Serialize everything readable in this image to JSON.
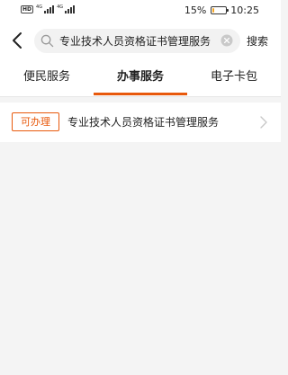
{
  "status_bar": {
    "hd_label": "HD",
    "signal_1_label": "4G",
    "signal_2_label": "4G",
    "battery_percent": "15%",
    "battery_level": 0.15,
    "time": "10:25"
  },
  "header": {
    "search_value": "专业技术人员资格证书管理服务",
    "search_button_label": "搜索"
  },
  "tabs": [
    {
      "label": "便民服务",
      "active": false
    },
    {
      "label": "办事服务",
      "active": true
    },
    {
      "label": "电子卡包",
      "active": false
    }
  ],
  "results": [
    {
      "badge": "可办理",
      "title": "专业技术人员资格证书管理服务"
    }
  ],
  "colors": {
    "accent": "#e8590c",
    "background": "#f4f4f4",
    "surface": "#ffffff"
  }
}
